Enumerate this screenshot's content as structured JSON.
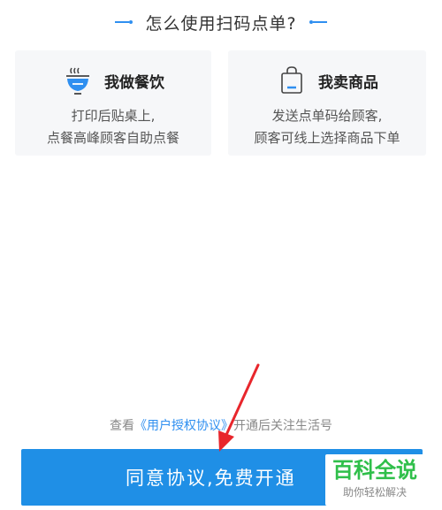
{
  "header": {
    "title": "怎么使用扫码点单?"
  },
  "cards": [
    {
      "label": "我做餐饮",
      "icon": "bowl-icon",
      "desc_line1": "打印后贴桌上,",
      "desc_line2": "点餐高峰顾客自助点餐"
    },
    {
      "label": "我卖商品",
      "icon": "shopping-bag-icon",
      "desc_line1": "发送点单码给顾客,",
      "desc_line2": "顾客可线上选择商品下单"
    }
  ],
  "agreement": {
    "prefix": "查看",
    "link": "《用户授权协议》",
    "suffix": "开通后关注生活号"
  },
  "cta": {
    "label": "同意协议,免费开通"
  },
  "watermark": {
    "main": "百科全说",
    "sub": "助你轻松解决"
  },
  "colors": {
    "accent": "#2f8ff0",
    "button": "#1f8fe6",
    "arrow": "#e8262c",
    "watermark": "#2fbf4a"
  }
}
